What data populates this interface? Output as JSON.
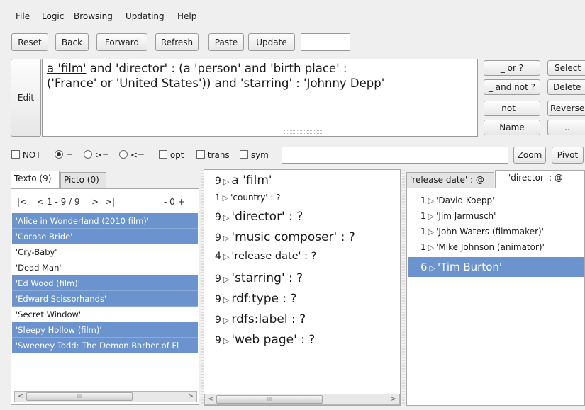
{
  "menu": [
    "File",
    "Logic",
    "Browsing",
    "Updating",
    "Help"
  ],
  "toolbar": {
    "reset": "Reset",
    "back": "Back",
    "forward": "Forward",
    "refresh": "Refresh",
    "paste": "Paste",
    "update": "Update",
    "input_value": ""
  },
  "query": {
    "edit_label": "Edit",
    "focus": "a 'film'",
    "rest_line1": " and 'director' : (a 'person' and 'birth place' :",
    "line2": "('France' or 'United States')) and 'starring' : 'Johnny Depp'"
  },
  "ops": {
    "or": "_ or ?",
    "and_not": "_ and not ?",
    "not": "not _",
    "name": "Name",
    "select": "Select",
    "delete": "Delete",
    "reverse": "Reverse",
    "more": ".."
  },
  "options": {
    "not": "NOT",
    "eq": "=",
    "gte": ">=",
    "lte": "<=",
    "opt": "opt",
    "trans": "trans",
    "sym": "sym",
    "filter_value": "",
    "zoom": "Zoom",
    "pivot": "Pivot"
  },
  "left": {
    "tab_texto": "Texto (9)",
    "tab_picto": "Picto (0)",
    "nav_first": "|<",
    "nav_prev": "<",
    "nav_range": "1 - 9 / 9",
    "nav_next": ">",
    "nav_last": ">|",
    "nav_zoom": "- 0 +",
    "items": [
      {
        "label": "'Alice in Wonderland (2010 film)'",
        "selected": true
      },
      {
        "label": "'Corpse Bride'",
        "selected": true
      },
      {
        "label": "'Cry-Baby'",
        "selected": false
      },
      {
        "label": "'Dead Man'",
        "selected": false
      },
      {
        "label": "'Ed Wood (film)'",
        "selected": true
      },
      {
        "label": "'Edward Scissorhands'",
        "selected": true
      },
      {
        "label": "'Secret Window'",
        "selected": false
      },
      {
        "label": "'Sleepy Hollow (film)'",
        "selected": true
      },
      {
        "label": "'Sweeney Todd: The Demon Barber of Fl",
        "selected": true
      }
    ]
  },
  "middle": {
    "items": [
      {
        "count": "9",
        "label": "a 'film'"
      },
      {
        "count": "1",
        "label": "'country' : ?"
      },
      {
        "count": "9",
        "label": "'director' : ?"
      },
      {
        "count": "9",
        "label": "'music composer' : ?"
      },
      {
        "count": "4",
        "label": "'release date' : ?"
      },
      {
        "count": "9",
        "label": "'starring' : ?"
      },
      {
        "count": "9",
        "label": "rdf:type : ?"
      },
      {
        "count": "9",
        "label": "rdfs:label : ?"
      },
      {
        "count": "9",
        "label": "'web page' : ?"
      }
    ]
  },
  "right": {
    "tab_release": "'release date' : @",
    "tab_director": "'director' : @",
    "items": [
      {
        "count": "1",
        "label": "'David Koepp'",
        "selected": false
      },
      {
        "count": "1",
        "label": "'Jim Jarmusch'",
        "selected": false
      },
      {
        "count": "1",
        "label": "'John Waters (filmmaker)'",
        "selected": false
      },
      {
        "count": "1",
        "label": "'Mike Johnson (animator)'",
        "selected": false
      },
      {
        "count": "6",
        "label": "'Tim Burton'",
        "selected": true
      }
    ]
  },
  "icons": {
    "expand": "▷",
    "scroll_left": "<",
    "scroll_right": ">",
    "grip": "III"
  },
  "colors": {
    "selection": "#6b93cd",
    "background": "#efefef"
  }
}
